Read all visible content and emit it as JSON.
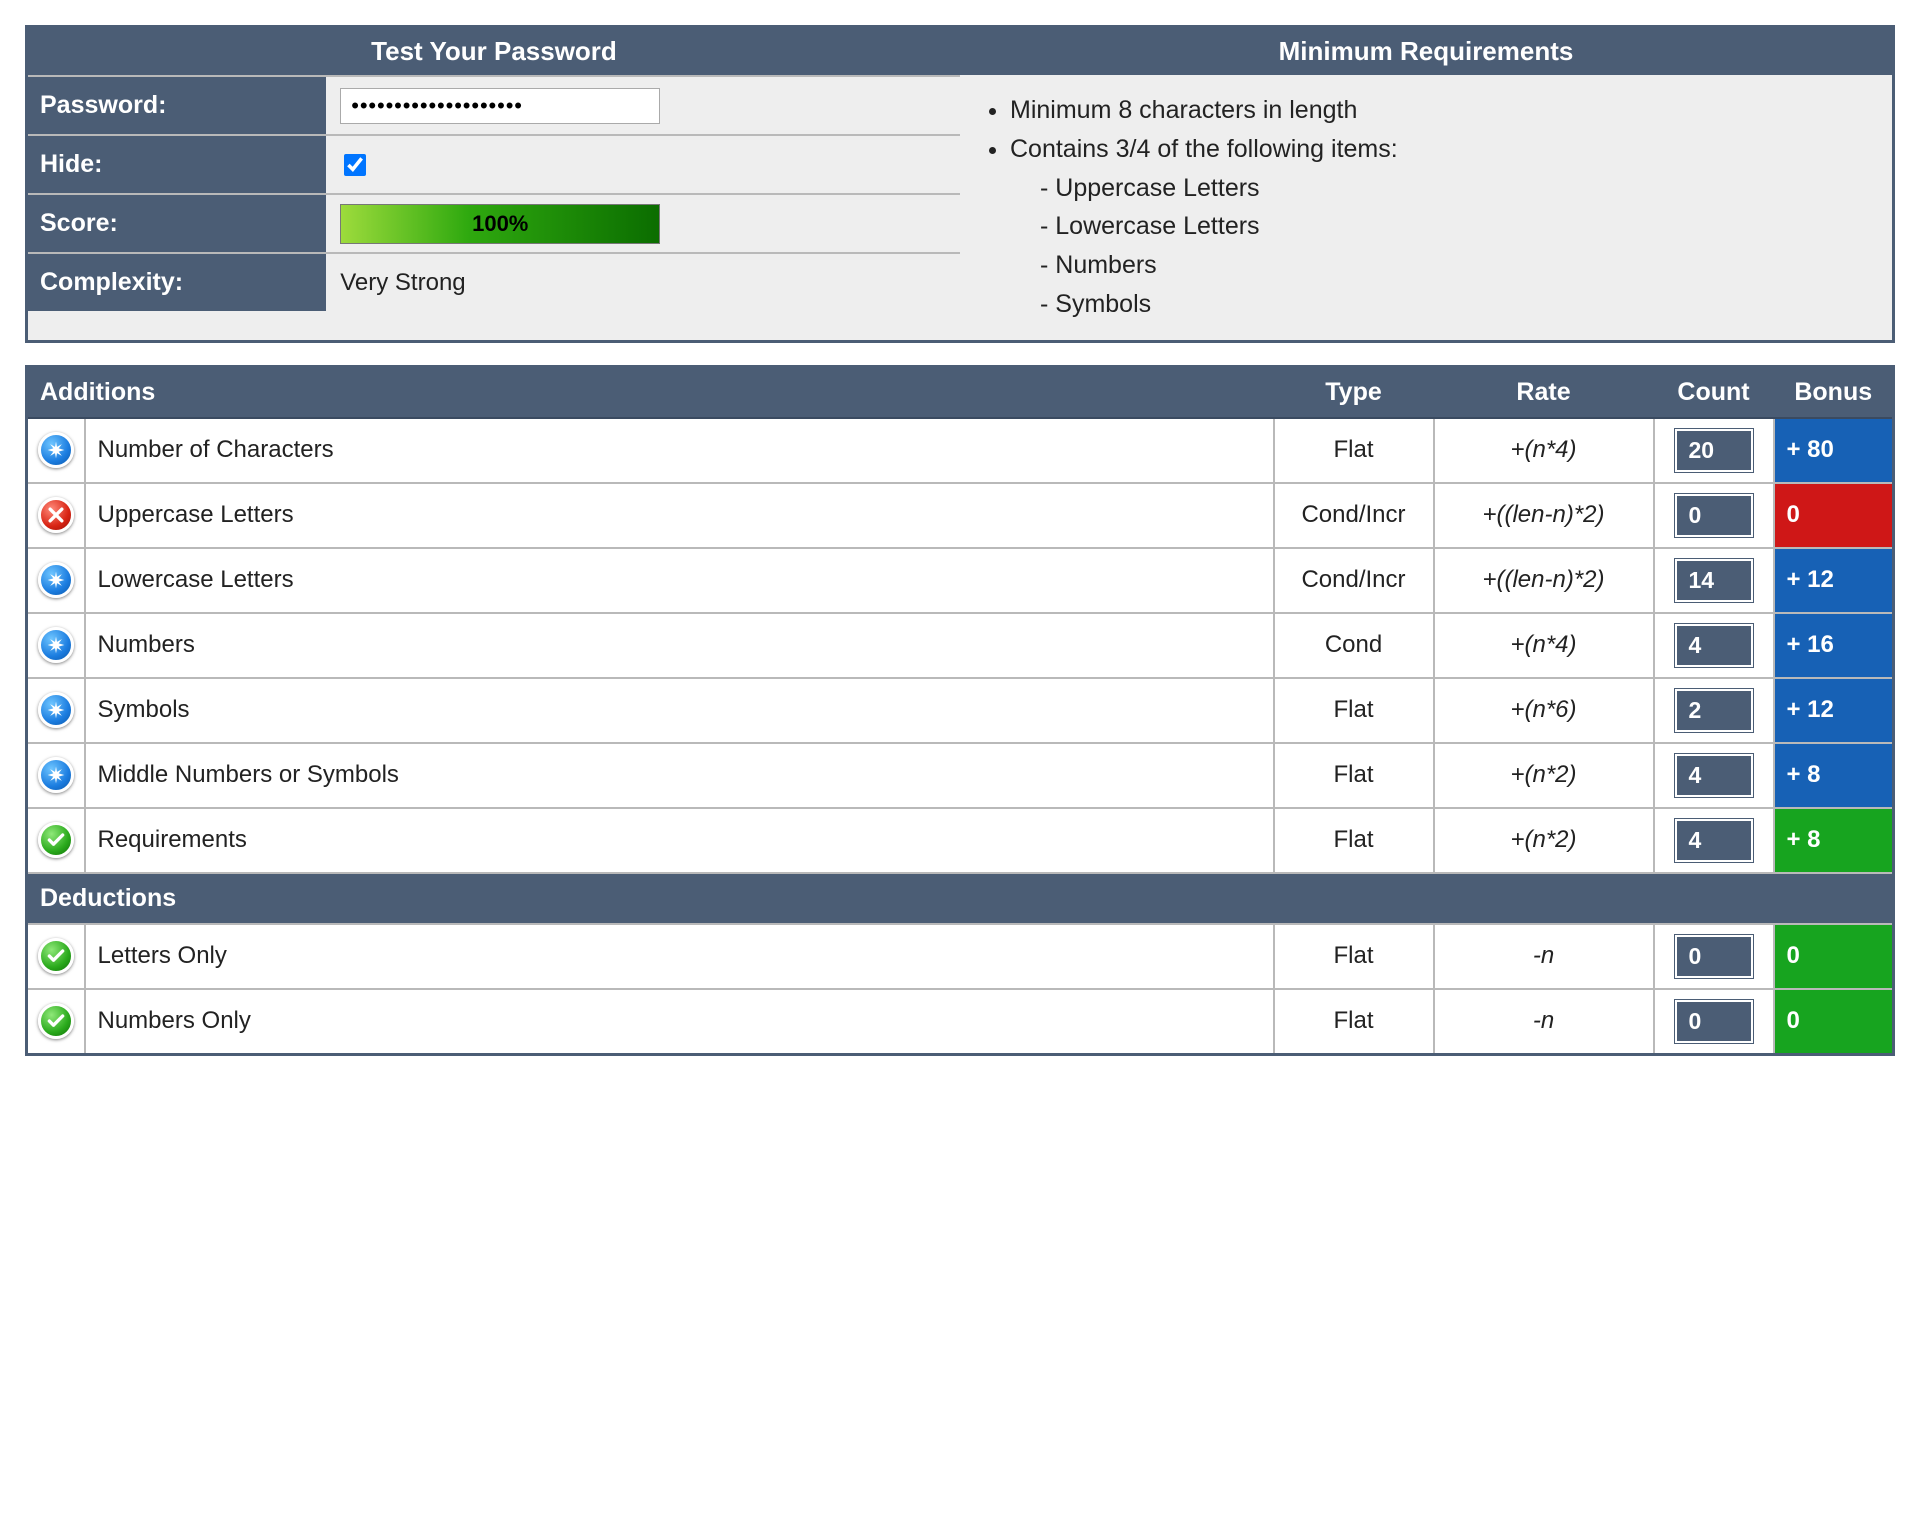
{
  "test_panel": {
    "title": "Test Your Password",
    "password_label": "Password:",
    "password_value": "••••••••••••••••••••",
    "hide_label": "Hide:",
    "hide_checked": true,
    "score_label": "Score:",
    "score_text": "100%",
    "score_percent": 100,
    "complexity_label": "Complexity:",
    "complexity_value": "Very Strong"
  },
  "requirements": {
    "title": "Minimum Requirements",
    "item1": "Minimum 8 characters in length",
    "item2": "Contains 3/4 of the following items:",
    "sub1": "- Uppercase Letters",
    "sub2": "- Lowercase Letters",
    "sub3": "- Numbers",
    "sub4": "- Symbols"
  },
  "headers": {
    "additions": "Additions",
    "deductions": "Deductions",
    "type": "Type",
    "rate": "Rate",
    "count": "Count",
    "bonus": "Bonus"
  },
  "additions": [
    {
      "status": "exceed",
      "name": "Number of Characters",
      "type": "Flat",
      "rate": "+(n*4)",
      "count": "20",
      "bonus": "+ 80",
      "bonus_style": "blue"
    },
    {
      "status": "fail",
      "name": "Uppercase Letters",
      "type": "Cond/Incr",
      "rate": "+((len-n)*2)",
      "count": "0",
      "bonus": "0",
      "bonus_style": "red"
    },
    {
      "status": "exceed",
      "name": "Lowercase Letters",
      "type": "Cond/Incr",
      "rate": "+((len-n)*2)",
      "count": "14",
      "bonus": "+ 12",
      "bonus_style": "blue"
    },
    {
      "status": "exceed",
      "name": "Numbers",
      "type": "Cond",
      "rate": "+(n*4)",
      "count": "4",
      "bonus": "+ 16",
      "bonus_style": "blue"
    },
    {
      "status": "exceed",
      "name": "Symbols",
      "type": "Flat",
      "rate": "+(n*6)",
      "count": "2",
      "bonus": "+ 12",
      "bonus_style": "blue"
    },
    {
      "status": "exceed",
      "name": "Middle Numbers or Symbols",
      "type": "Flat",
      "rate": "+(n*2)",
      "count": "4",
      "bonus": "+ 8",
      "bonus_style": "blue"
    },
    {
      "status": "pass",
      "name": "Requirements",
      "type": "Flat",
      "rate": "+(n*2)",
      "count": "4",
      "bonus": "+ 8",
      "bonus_style": "green"
    }
  ],
  "deductions": [
    {
      "status": "pass",
      "name": "Letters Only",
      "type": "Flat",
      "rate": "-n",
      "count": "0",
      "bonus": "0",
      "bonus_style": "green"
    },
    {
      "status": "pass",
      "name": "Numbers Only",
      "type": "Flat",
      "rate": "-n",
      "count": "0",
      "bonus": "0",
      "bonus_style": "green"
    }
  ],
  "icons": {
    "exceed": "asterisk-icon",
    "pass": "check-icon",
    "fail": "cross-icon"
  }
}
